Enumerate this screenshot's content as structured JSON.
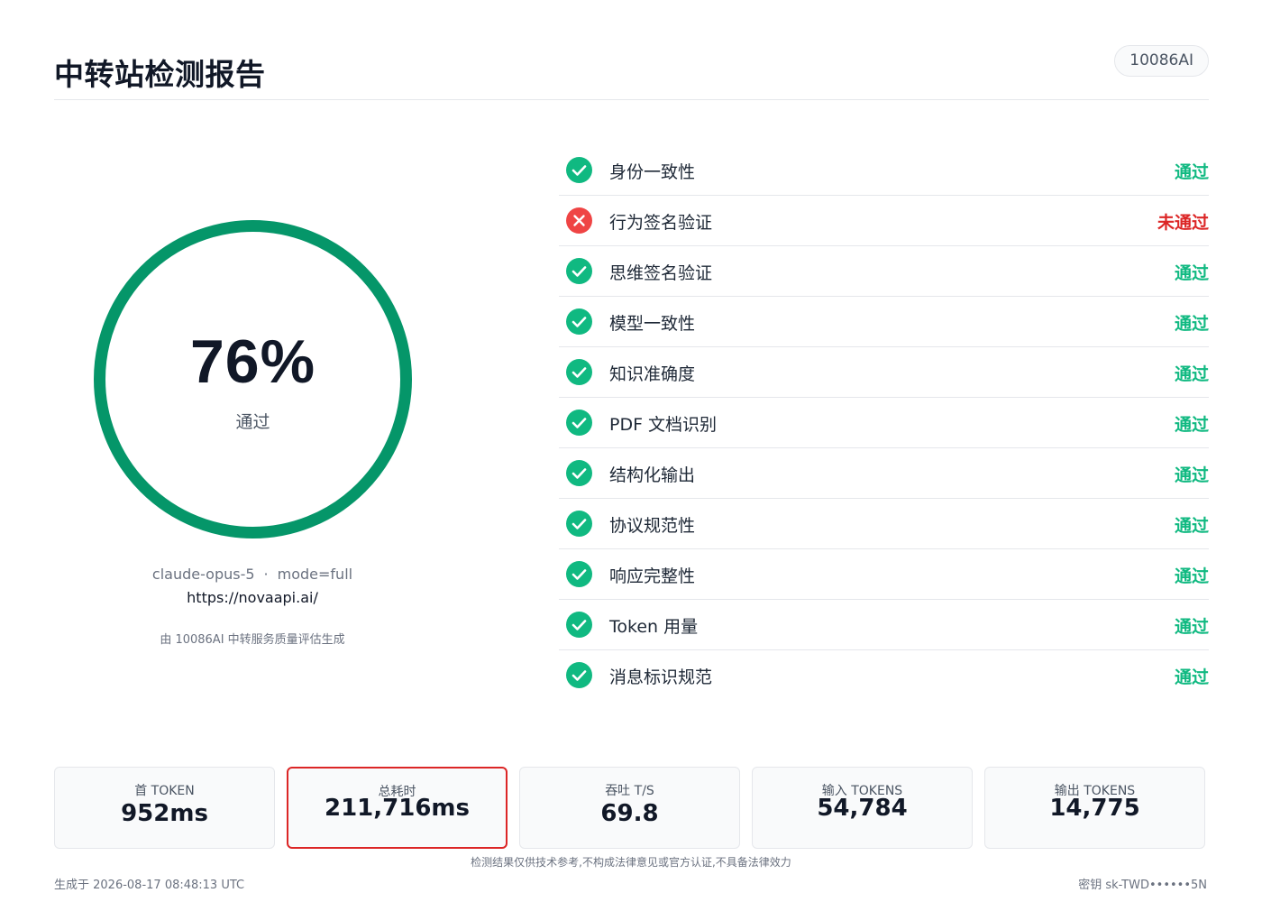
{
  "header": {
    "title": "中转站检测报告",
    "brand": "10086AI"
  },
  "score": {
    "value": "76%",
    "label": "通过",
    "ring_color": "#059669"
  },
  "meta": {
    "model": "claude-opus-5",
    "separator": "·",
    "mode": "mode=full",
    "url": "https://novaapi.ai/",
    "credit": "由 10086AI 中转服务质量评估生成"
  },
  "checks": [
    {
      "name": "身份一致性",
      "status": "通过",
      "passed": true
    },
    {
      "name": "行为签名验证",
      "status": "未通过",
      "passed": false
    },
    {
      "name": "思维签名验证",
      "status": "通过",
      "passed": true
    },
    {
      "name": "模型一致性",
      "status": "通过",
      "passed": true
    },
    {
      "name": "知识准确度",
      "status": "通过",
      "passed": true
    },
    {
      "name": "PDF 文档识别",
      "status": "通过",
      "passed": true
    },
    {
      "name": "结构化输出",
      "status": "通过",
      "passed": true
    },
    {
      "name": "协议规范性",
      "status": "通过",
      "passed": true
    },
    {
      "name": "响应完整性",
      "status": "通过",
      "passed": true
    },
    {
      "name": "Token 用量",
      "status": "通过",
      "passed": true
    },
    {
      "name": "消息标识规范",
      "status": "通过",
      "passed": true
    }
  ],
  "metrics": [
    {
      "label": "首 TOKEN",
      "value": "952ms"
    },
    {
      "label": "总耗时",
      "value": "211,716ms"
    },
    {
      "label": "吞吐 T/S",
      "value": "69.8"
    },
    {
      "label": "输入 TOKENS",
      "value": "54,784"
    },
    {
      "label": "输出 TOKENS",
      "value": "14,775"
    }
  ],
  "footer": {
    "disclaimer": "检测结果仅供技术参考,不构成法律意见或官方认证,不具备法律效力",
    "generated": "生成于 2026-08-17 08:48:13 UTC",
    "key": "密钥 sk-TWD••••••5N"
  },
  "colors": {
    "pass": "#10b981",
    "fail": "#dc2626",
    "highlight_border": "#dc2626"
  },
  "icons": {
    "pass": "check-circle-icon",
    "fail": "x-circle-icon"
  }
}
